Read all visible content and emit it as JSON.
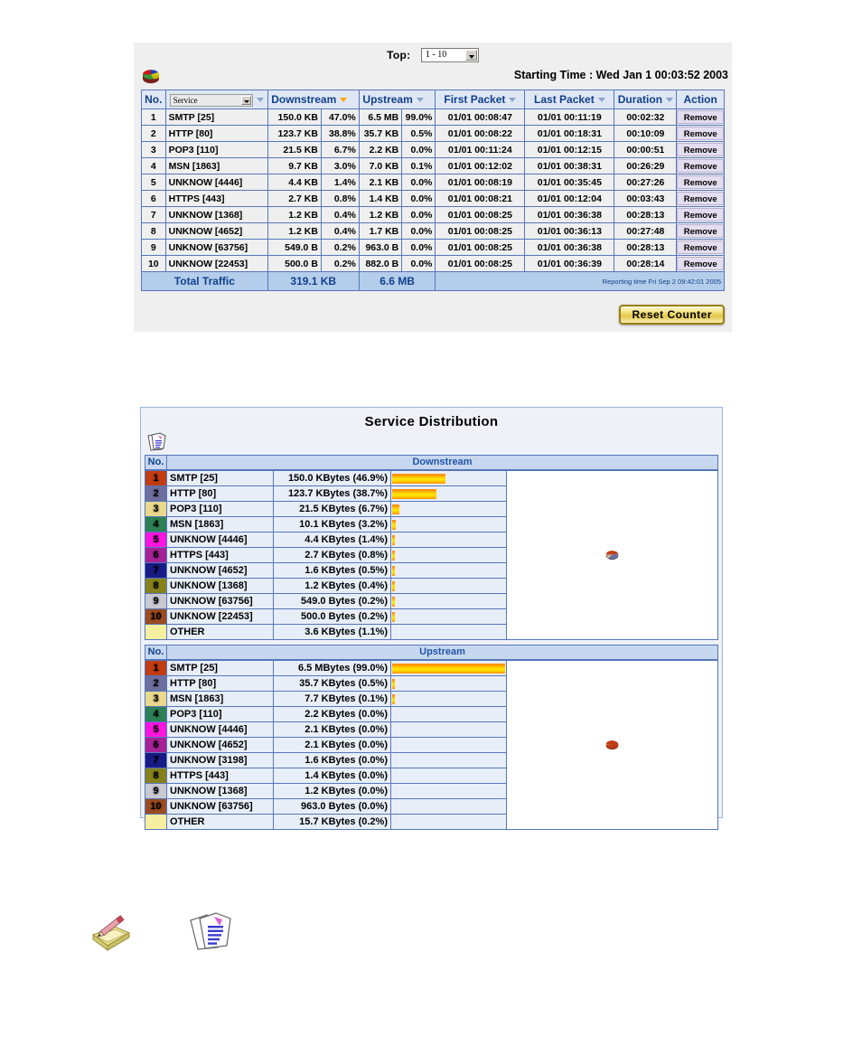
{
  "top_panel": {
    "top_label": "Top:",
    "top_select_value": "1 - 10",
    "pie_icon": "pie-chart-icon",
    "starting_time": "Starting Time : Wed Jan 1 00:03:52 2003",
    "columns": {
      "no": "No.",
      "service_select_value": "Service",
      "downstream": "Downstream",
      "upstream": "Upstream",
      "first_packet": "First Packet",
      "last_packet": "Last Packet",
      "duration": "Duration",
      "action": "Action"
    },
    "rows": [
      {
        "no": "1",
        "service": "SMTP [25]",
        "ds": "150.0 KB",
        "dsp": "47.0%",
        "us": "6.5 MB",
        "usp": "99.0%",
        "first": "01/01 00:08:47",
        "last": "01/01 00:11:19",
        "dur": "00:02:32",
        "action": "Remove"
      },
      {
        "no": "2",
        "service": "HTTP [80]",
        "ds": "123.7 KB",
        "dsp": "38.8%",
        "us": "35.7 KB",
        "usp": "0.5%",
        "first": "01/01 00:08:22",
        "last": "01/01 00:18:31",
        "dur": "00:10:09",
        "action": "Remove"
      },
      {
        "no": "3",
        "service": "POP3 [110]",
        "ds": "21.5 KB",
        "dsp": "6.7%",
        "us": "2.2 KB",
        "usp": "0.0%",
        "first": "01/01 00:11:24",
        "last": "01/01 00:12:15",
        "dur": "00:00:51",
        "action": "Remove"
      },
      {
        "no": "4",
        "service": "MSN [1863]",
        "ds": "9.7 KB",
        "dsp": "3.0%",
        "us": "7.0 KB",
        "usp": "0.1%",
        "first": "01/01 00:12:02",
        "last": "01/01 00:38:31",
        "dur": "00:26:29",
        "action": "Remove"
      },
      {
        "no": "5",
        "service": "UNKNOW [4446]",
        "ds": "4.4 KB",
        "dsp": "1.4%",
        "us": "2.1 KB",
        "usp": "0.0%",
        "first": "01/01 00:08:19",
        "last": "01/01 00:35:45",
        "dur": "00:27:26",
        "action": "Remove"
      },
      {
        "no": "6",
        "service": "HTTPS [443]",
        "ds": "2.7 KB",
        "dsp": "0.8%",
        "us": "1.4 KB",
        "usp": "0.0%",
        "first": "01/01 00:08:21",
        "last": "01/01 00:12:04",
        "dur": "00:03:43",
        "action": "Remove"
      },
      {
        "no": "7",
        "service": "UNKNOW [1368]",
        "ds": "1.2 KB",
        "dsp": "0.4%",
        "us": "1.2 KB",
        "usp": "0.0%",
        "first": "01/01 00:08:25",
        "last": "01/01 00:36:38",
        "dur": "00:28:13",
        "action": "Remove"
      },
      {
        "no": "8",
        "service": "UNKNOW [4652]",
        "ds": "1.2 KB",
        "dsp": "0.4%",
        "us": "1.7 KB",
        "usp": "0.0%",
        "first": "01/01 00:08:25",
        "last": "01/01 00:36:13",
        "dur": "00:27:48",
        "action": "Remove"
      },
      {
        "no": "9",
        "service": "UNKNOW [63756]",
        "ds": "549.0 B",
        "dsp": "0.2%",
        "us": "963.0 B",
        "usp": "0.0%",
        "first": "01/01 00:08:25",
        "last": "01/01 00:36:38",
        "dur": "00:28:13",
        "action": "Remove"
      },
      {
        "no": "10",
        "service": "UNKNOW [22453]",
        "ds": "500.0 B",
        "dsp": "0.2%",
        "us": "882.0 B",
        "usp": "0.0%",
        "first": "01/01 00:08:25",
        "last": "01/01 00:36:39",
        "dur": "00:28:14",
        "action": "Remove"
      }
    ],
    "total": {
      "label": "Total Traffic",
      "downstream": "319.1 KB",
      "upstream": "6.6 MB",
      "reporting": "Reporting time Fri Sep 2 09:42:01 2005"
    },
    "reset_button": "Reset Counter"
  },
  "dist_panel": {
    "title": "Service Distribution",
    "icon": "documents-icon",
    "no_header": "No.",
    "downstream_header": "Downstream",
    "upstream_header": "Upstream"
  },
  "chart_data": [
    {
      "type": "pie",
      "title": "Downstream",
      "total": "319.1 KB",
      "categories": [
        "SMTP [25]",
        "HTTP [80]",
        "POP3 [110]",
        "MSN [1863]",
        "UNKNOW [4446]",
        "HTTPS [443]",
        "UNKNOW [4652]",
        "UNKNOW [1368]",
        "UNKNOW [63756]",
        "UNKNOW [22453]",
        "OTHER"
      ],
      "values": [
        46.9,
        38.7,
        6.7,
        3.2,
        1.4,
        0.8,
        0.5,
        0.4,
        0.2,
        0.2,
        1.1
      ],
      "value_labels": [
        "150.0 KBytes (46.9%)",
        "123.7 KBytes (38.7%)",
        "21.5 KBytes (6.7%)",
        "10.1 KBytes (3.2%)",
        "4.4 KBytes (1.4%)",
        "2.7 KBytes (0.8%)",
        "1.6 KBytes (0.5%)",
        "1.2 KBytes (0.4%)",
        "549.0 Bytes (0.2%)",
        "500.0 Bytes (0.2%)",
        "3.6 KBytes (1.1%)"
      ],
      "ranks": [
        "1",
        "2",
        "3",
        "4",
        "5",
        "6",
        "7",
        "8",
        "9",
        "10",
        ""
      ],
      "colors": [
        "#c23c12",
        "#6d6e9e",
        "#ead88d",
        "#2d8055",
        "#ff15e0",
        "#a62097",
        "#181a85",
        "#86811b",
        "#c8c9d2",
        "#9c4c20",
        "#f6efa0"
      ],
      "legend_position": "left"
    },
    {
      "type": "pie",
      "title": "Upstream",
      "total": "6.6 MB",
      "categories": [
        "SMTP [25]",
        "HTTP [80]",
        "MSN [1863]",
        "POP3 [110]",
        "UNKNOW [4446]",
        "UNKNOW [4652]",
        "UNKNOW [3198]",
        "HTTPS [443]",
        "UNKNOW [1368]",
        "UNKNOW [63756]",
        "OTHER"
      ],
      "values": [
        99.0,
        0.5,
        0.1,
        0.0,
        0.0,
        0.0,
        0.0,
        0.0,
        0.0,
        0.0,
        0.2
      ],
      "value_labels": [
        "6.5 MBytes (99.0%)",
        "35.7 KBytes (0.5%)",
        "7.7 KBytes (0.1%)",
        "2.2 KBytes (0.0%)",
        "2.1 KBytes (0.0%)",
        "2.1 KBytes (0.0%)",
        "1.6 KBytes (0.0%)",
        "1.4 KBytes (0.0%)",
        "1.2 KBytes (0.0%)",
        "963.0 Bytes (0.0%)",
        "15.7 KBytes (0.2%)"
      ],
      "ranks": [
        "1",
        "2",
        "3",
        "4",
        "5",
        "6",
        "7",
        "8",
        "9",
        "10",
        ""
      ],
      "colors": [
        "#c23c12",
        "#6d6e9e",
        "#ead88d",
        "#2d8055",
        "#ff15e0",
        "#a62097",
        "#181a85",
        "#86811b",
        "#c8c9d2",
        "#9c4c20",
        "#f6efa0"
      ],
      "legend_position": "left"
    }
  ],
  "footer_icons": [
    {
      "name": "note-pencil-icon"
    },
    {
      "name": "clipboard-docs-icon"
    }
  ]
}
